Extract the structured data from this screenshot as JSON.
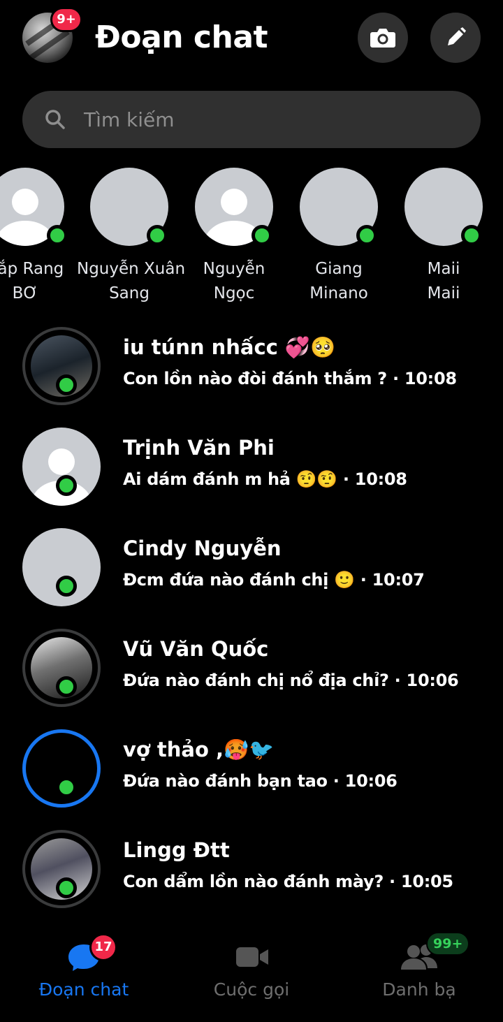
{
  "header": {
    "title": "Đoạn chat",
    "profile_badge": "9+",
    "camera_icon": "camera-icon",
    "edit_icon": "pencil-icon"
  },
  "search": {
    "placeholder": "Tìm kiếm",
    "icon": "search-icon"
  },
  "stories": [
    {
      "name_line1": "Bắp Rang",
      "name_line2": "BƠ",
      "online": true
    },
    {
      "name_line1": "Nguyễn Xuân",
      "name_line2": "Sang",
      "online": true
    },
    {
      "name_line1": "Nguyễn",
      "name_line2": "Ngọc",
      "online": true
    },
    {
      "name_line1": "Giang",
      "name_line2": "Minano",
      "online": true
    },
    {
      "name_line1": "Maii",
      "name_line2": "Maii",
      "online": true
    }
  ],
  "conversations": [
    {
      "name": "iu túnn nhấcc 💞🥺",
      "preview": "Con lồn nào đòi đánh thắm ? · 10:08",
      "online": true
    },
    {
      "name": "Trịnh Văn Phi",
      "preview": "Ai dám đánh m hả 🤨🤨 · 10:08",
      "online": true
    },
    {
      "name": "Cindy Nguyễn",
      "preview": "Đcm đứa nào đánh chị 🙂 · 10:07",
      "online": true
    },
    {
      "name": "Vũ Văn Quốc",
      "preview": "Đứa nào đánh chị nổ địa chỉ? · 10:06",
      "online": true
    },
    {
      "name": "vợ thảo ,🥵🐦",
      "preview": "Đứa nào đánh bạn tao · 10:06",
      "online": true
    },
    {
      "name": "Lingg Đtt",
      "preview": "Con dẩm lồn nào đánh mày? · 10:05",
      "online": true
    }
  ],
  "bottom_nav": {
    "tabs": [
      {
        "label": "Đoạn chat",
        "icon": "chat-bubble-icon",
        "badge": "17",
        "active": true
      },
      {
        "label": "Cuộc gọi",
        "icon": "video-camera-icon",
        "active": false
      },
      {
        "label": "Danh bạ",
        "icon": "people-icon",
        "badge": "99+",
        "active": false
      }
    ]
  },
  "colors": {
    "background": "#000000",
    "accent": "#1877f2",
    "online": "#31cc46",
    "badge": "#f02849"
  }
}
